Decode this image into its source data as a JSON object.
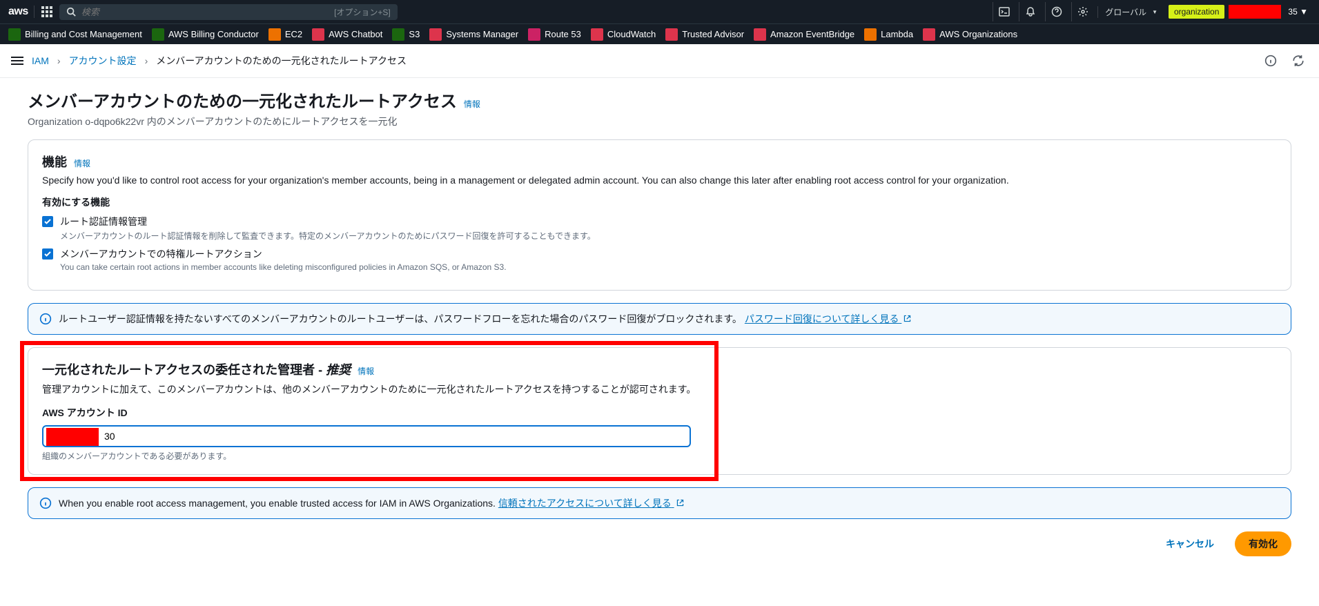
{
  "topnav": {
    "logo": "aws",
    "search_placeholder": "検索",
    "search_hint": "[オプション+S]",
    "region": "グローバル",
    "account_prefix": "organization",
    "account_suffix": "35"
  },
  "services": [
    {
      "label": "Billing and Cost Management",
      "color": "svc-green"
    },
    {
      "label": "AWS Billing Conductor",
      "color": "svc-green"
    },
    {
      "label": "EC2",
      "color": "svc-orange"
    },
    {
      "label": "AWS Chatbot",
      "color": "svc-red"
    },
    {
      "label": "S3",
      "color": "svc-green"
    },
    {
      "label": "Systems Manager",
      "color": "svc-red"
    },
    {
      "label": "Route 53",
      "color": "svc-pink"
    },
    {
      "label": "CloudWatch",
      "color": "svc-red"
    },
    {
      "label": "Trusted Advisor",
      "color": "svc-red"
    },
    {
      "label": "Amazon EventBridge",
      "color": "svc-red"
    },
    {
      "label": "Lambda",
      "color": "svc-orange"
    },
    {
      "label": "AWS Organizations",
      "color": "svc-red"
    }
  ],
  "breadcrumb": {
    "root": "IAM",
    "settings": "アカウント設定",
    "current": "メンバーアカウントのための一元化されたルートアクセス"
  },
  "page": {
    "title": "メンバーアカウントのための一元化されたルートアクセス",
    "info": "情報",
    "subtitle": "Organization o-dqpo6k22vr 内のメンバーアカウントのためにルートアクセスを一元化"
  },
  "features": {
    "title": "機能",
    "info": "情報",
    "desc": "Specify how you'd like to control root access for your organization's member accounts, being in a management or delegated admin account. You can also change this later after enabling root access control for your organization.",
    "enable_label": "有効にする機能",
    "items": [
      {
        "label": "ルート認証情報管理",
        "sub": "メンバーアカウントのルート認証情報を削除して監査できます。特定のメンバーアカウントのためにパスワード回復を許可することもできます。"
      },
      {
        "label": "メンバーアカウントでの特権ルートアクション",
        "sub": "You can take certain root actions in member accounts like deleting misconfigured policies in Amazon SQS, or Amazon S3."
      }
    ]
  },
  "alert1": {
    "text": "ルートユーザー認証情報を持たないすべてのメンバーアカウントのルートユーザーは、パスワードフローを忘れた場合のパスワード回復がブロックされます。",
    "link": "パスワード回復について詳しく見る"
  },
  "delegated": {
    "title": "一元化されたルートアクセスの委任された管理者 - ",
    "recommended": "推奨",
    "info": "情報",
    "desc": "管理アカウントに加えて、このメンバーアカウントは、他のメンバーアカウントのために一元化されたルートアクセスを持つすることが認可されます。",
    "account_label": "AWS アカウント ID",
    "account_value": "30",
    "account_hint": "組織のメンバーアカウントである必要があります。"
  },
  "alert2": {
    "text": "When you enable root access management, you enable trusted access for IAM in AWS Organizations.",
    "link": "信頼されたアクセスについて詳しく見る"
  },
  "actions": {
    "cancel": "キャンセル",
    "enable": "有効化"
  }
}
